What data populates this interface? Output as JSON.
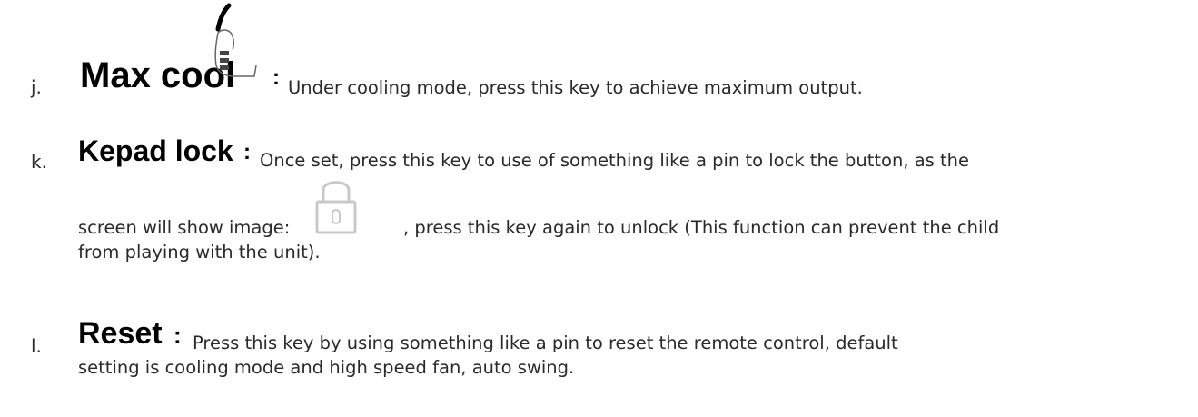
{
  "entries": [
    {
      "letter": "j.",
      "key": "Max cool",
      "colon": ":",
      "desc": "Under cooling mode, press this key to achieve maximum output.",
      "icon": "thumbs-up-icon"
    },
    {
      "letter": "k.",
      "key": "Kepad lock",
      "colon": ":",
      "desc_line1": "Once set, press this key to use of something like a pin to lock the button, as the",
      "desc_line2a": "screen will show image:",
      "desc_line2b": ", press this key again to unlock (This function can prevent the child",
      "desc_line3": "from playing with the unit).",
      "icon": "padlock-icon"
    },
    {
      "letter": "l.",
      "key": "Reset",
      "colon": ":",
      "desc_line1": "Press this key by using something like a pin to reset the remote control, default",
      "desc_line2": "setting is cooling mode and high speed fan, auto swing."
    }
  ]
}
